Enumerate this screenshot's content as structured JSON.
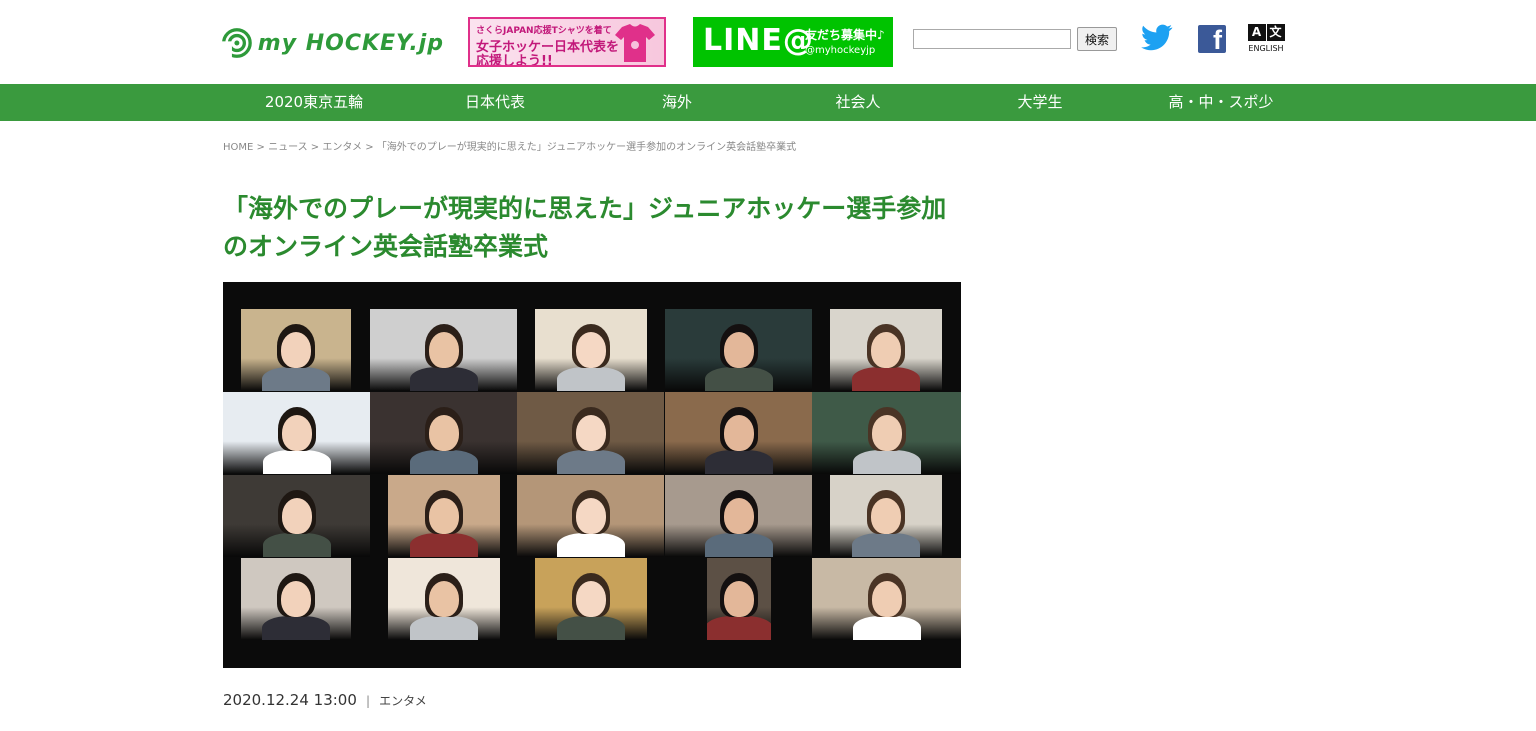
{
  "header": {
    "logo_text": "my HOCKEY.jp",
    "banner_sakura": {
      "line1": "さくらJAPAN応援Tシャツを着て",
      "line2": "女子ホッケー日本代表を",
      "line3": "応援しよう!!"
    },
    "banner_line": {
      "big": "LINE@",
      "line1": "友だち募集中♪",
      "line2": "@myhockeyjp"
    },
    "search": {
      "placeholder": "",
      "button_label": "検索"
    },
    "english_label": "ENGLISH",
    "english_glyph_a": "A",
    "english_glyph_b": "文"
  },
  "nav": {
    "items": [
      "2020東京五輪",
      "日本代表",
      "海外",
      "社会人",
      "大学生",
      "高・中・スポ少"
    ]
  },
  "breadcrumb": {
    "home": "HOME",
    "sep": " > ",
    "news": "ニュース",
    "category": "エンタメ",
    "current": "「海外でのプレーが現実的に思えた」ジュニアホッケー選手参加のオンライン英会話塾卒業式"
  },
  "article": {
    "title": "「海外でのプレーが現実的に思えた」ジュニアホッケー選手参加のオンライン英会話塾卒業式",
    "date": "2020.12.24 13:00",
    "separator": "|",
    "category": "エンタメ"
  },
  "colors": {
    "brand_green": "#3a9a3e",
    "title_green": "#2b8a2f",
    "line_green": "#00c300",
    "sakura_pink": "#e0308a",
    "twitter_blue": "#1da1f2",
    "facebook_blue": "#3b5998"
  },
  "icons": {
    "logo": "hockey-swirl-logo-icon",
    "twitter": "twitter-bird-icon",
    "facebook": "facebook-f-icon",
    "english": "language-translate-icon",
    "tshirt": "tshirt-icon"
  }
}
